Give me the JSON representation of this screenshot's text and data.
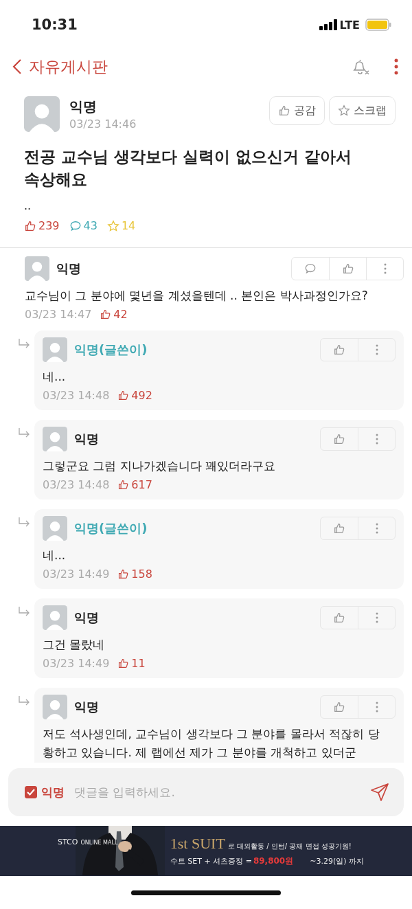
{
  "status_bar": {
    "time": "10:31",
    "network": "LTE"
  },
  "nav": {
    "back_label": "자유게시판"
  },
  "post": {
    "author": "익명",
    "time": "03/23 14:46",
    "buttons": [
      "공감",
      "스크랩"
    ],
    "title": "전공 교수님 생각보다 실력이 없으신거 같아서 속상해요",
    "body": "..",
    "likes": "239",
    "comments": "43",
    "scraps": "14"
  },
  "comments": [
    {
      "author": "익명",
      "is_writer": false,
      "text": "교수님이 그 분야에 몇년을 계셨을텐데 .. 본인은 박사과정인가요?",
      "time": "03/23 14:47",
      "likes": "42",
      "children": [
        {
          "author": "익명(글쓴이)",
          "is_writer": true,
          "text": "네...",
          "time": "03/23 14:48",
          "likes": "492"
        },
        {
          "author": "익명",
          "is_writer": false,
          "text": "그렇군요 그럼 지나가겠습니다 꽤있더라구요",
          "time": "03/23 14:48",
          "likes": "617"
        },
        {
          "author": "익명(글쓴이)",
          "is_writer": true,
          "text": "네...",
          "time": "03/23 14:49",
          "likes": "158"
        },
        {
          "author": "익명",
          "is_writer": false,
          "text": "그건 몰랐네",
          "time": "03/23 14:49",
          "likes": "11"
        },
        {
          "author": "익명",
          "is_writer": false,
          "text": "저도 석사생인데, 교수님이 생각보다 그 분야를 몰라서 적잖히 당황하고 있습니다. 제 랩에선 제가 그 분야를 개척하고 있더군"
        }
      ]
    }
  ],
  "composer": {
    "anonymous": true,
    "anonymous_label": "익명",
    "placeholder": "댓글을 입력하세요."
  },
  "ad": {
    "brand": "STCO",
    "brand_sub": "ONLINE MALL",
    "headline": "1st SUIT",
    "headline_rest": "로 대외활동 / 인턴/ 공채 면접 성공기원!",
    "offer": "수트 SET + 셔츠증정 =",
    "price": "89,800원",
    "period": "~3.29(일) 까지"
  }
}
